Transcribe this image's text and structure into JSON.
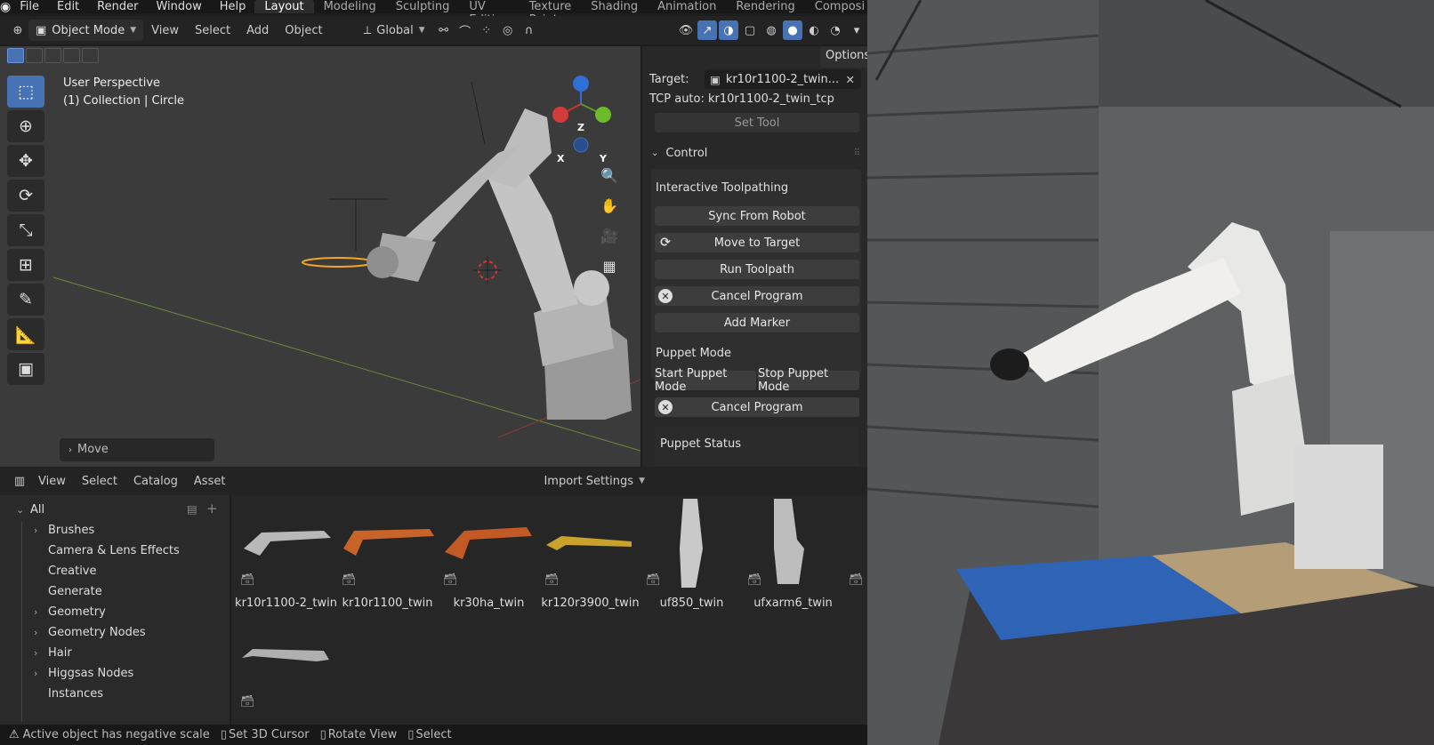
{
  "topbar": {
    "menus": [
      "File",
      "Edit",
      "Render",
      "Window",
      "Help"
    ],
    "workspaces": [
      "Layout",
      "Modeling",
      "Sculpting",
      "UV Editing",
      "Texture Paint",
      "Shading",
      "Animation",
      "Rendering",
      "Composi"
    ],
    "active_workspace": "Layout"
  },
  "header": {
    "mode": "Object Mode",
    "menus": [
      "View",
      "Select",
      "Add",
      "Object"
    ],
    "transform_orientation": "Global",
    "options": "Options"
  },
  "viewport": {
    "view_name": "User Perspective",
    "collection": "(1) Collection | Circle",
    "gizmo_axes": [
      "Z",
      "X",
      "Y"
    ],
    "last_op": "Move"
  },
  "npanel": {
    "target_label": "Target:",
    "target_value": "kr10r1100-2_twin...",
    "tcp": "TCP auto: kr10r1100-2_twin_tcp",
    "set_tool": "Set Tool",
    "control_title": "Control",
    "interactive_title": "Interactive Toolpathing",
    "sync": "Sync From Robot",
    "move_target": "Move to Target",
    "run_toolpath": "Run Toolpath",
    "cancel_program": "Cancel Program",
    "add_marker": "Add Marker",
    "puppet_title": "Puppet Mode",
    "start_puppet": "Start Puppet Mode",
    "stop_puppet": "Stop Puppet Mode",
    "cancel_program_2": "Cancel Program",
    "puppet_status": "Puppet Status"
  },
  "asset_header": {
    "menus": [
      "View",
      "Select",
      "Catalog",
      "Asset"
    ],
    "import_settings": "Import Settings"
  },
  "catalog": {
    "root": "All",
    "items": [
      {
        "label": "Brushes",
        "expandable": true
      },
      {
        "label": "Camera & Lens Effects",
        "expandable": false
      },
      {
        "label": "Creative",
        "expandable": false
      },
      {
        "label": "Generate",
        "expandable": false
      },
      {
        "label": "Geometry",
        "expandable": true
      },
      {
        "label": "Geometry Nodes",
        "expandable": true
      },
      {
        "label": "Hair",
        "expandable": true
      },
      {
        "label": "Higgsas Nodes",
        "expandable": true
      },
      {
        "label": "Instances",
        "expandable": false
      }
    ]
  },
  "assets": [
    {
      "name": "kr10r1100-2_twin",
      "color": "#b8b8b8"
    },
    {
      "name": "kr10r1100_twin",
      "color": "#c8642a"
    },
    {
      "name": "kr30ha_twin",
      "color": "#c35a26"
    },
    {
      "name": "kr120r3900_twin",
      "color": "#c9a22c"
    },
    {
      "name": "uf850_twin",
      "color": "#c9c9c9"
    },
    {
      "name": "ufxarm6_twin",
      "color": "#bdbdbd"
    },
    {
      "name": "",
      "color": "#b0b0b0"
    }
  ],
  "status": {
    "warning": "Active object has negative scale",
    "hint1": "Set 3D Cursor",
    "hint2": "Rotate View",
    "hint3": "Select"
  }
}
